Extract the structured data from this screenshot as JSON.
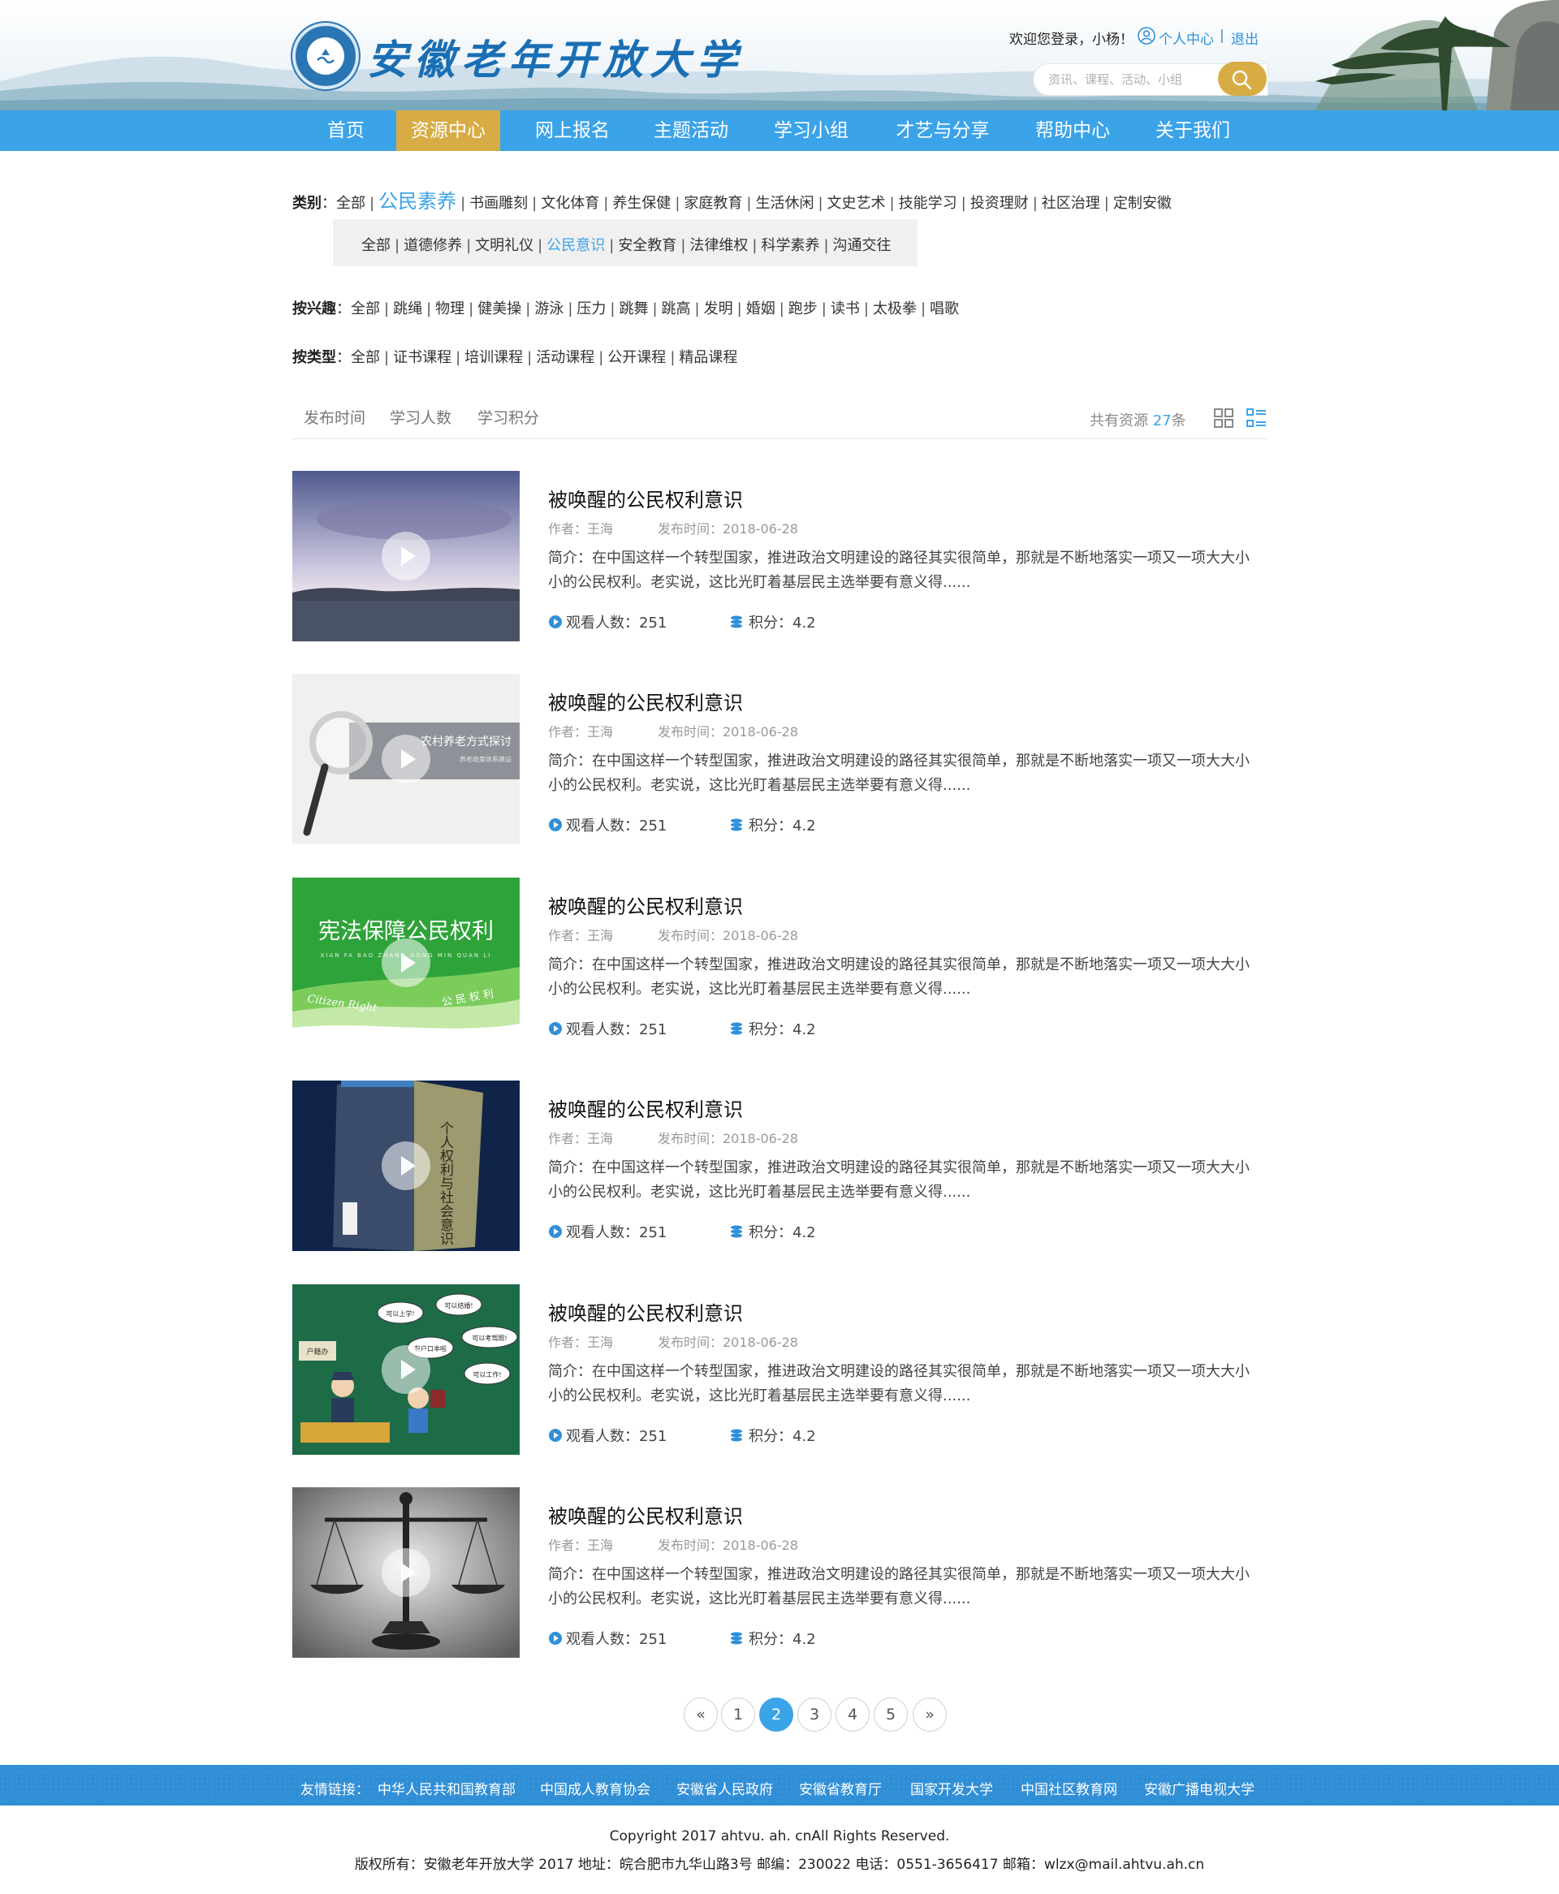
{
  "header": {
    "site_title": "安徽老年开放大学",
    "welcome": "欢迎您登录，小杨！",
    "user_center": "个人中心",
    "separator": "|",
    "logout": "退出",
    "search_placeholder": "资讯、课程、活动、小组"
  },
  "nav": {
    "items": [
      "首页",
      "资源中心",
      "网上报名",
      "主题活动",
      "学习小组",
      "才艺与分享",
      "帮助中心",
      "关于我们"
    ],
    "active_index": 1
  },
  "filters": {
    "category_label": "类别",
    "category_options": [
      "全部",
      "公民素养",
      "书画雕刻",
      "文化体育",
      "养生保健",
      "家庭教育",
      "生活休闲",
      "文史艺术",
      "技能学习",
      "投资理财",
      "社区治理",
      "定制安徽"
    ],
    "category_selected": "公民素养",
    "sub_options": [
      "全部",
      "道德修养",
      "文明礼仪",
      "公民意识",
      "安全教育",
      "法律维权",
      "科学素养",
      "沟通交往"
    ],
    "sub_selected": "公民意识",
    "interest_label": "按兴趣",
    "interest_options": [
      "全部",
      "跳绳",
      "物理",
      "健美操",
      "游泳",
      "压力",
      "跳舞",
      "跳高",
      "发明",
      "婚姻",
      "跑步",
      "读书",
      "太极拳",
      "唱歌"
    ],
    "type_label": "按类型",
    "type_options": [
      "全部",
      "证书课程",
      "培训课程",
      "活动课程",
      "公开课程",
      "精品课程"
    ]
  },
  "sortbar": {
    "tabs": [
      "发布时间",
      "学习人数",
      "学习积分"
    ],
    "active_index": 0,
    "total_prefix": "共有资源",
    "total_count": "27",
    "total_suffix": "条"
  },
  "list": {
    "items": [
      {
        "title": "被唤醒的公民权利意识",
        "author": "作者：王海",
        "date": "发布时间：2018-06-28",
        "desc": "简介：在中国这样一个转型国家，推进政治文明建设的路径其实很简单，那就是不断地落实一项又一项大大小小的公民权利。老实说，这比光盯着基层民主选举要有意义得......",
        "views": "观看人数：251",
        "points": "积分：4.2",
        "thumb": "lake"
      },
      {
        "title": "被唤醒的公民权利意识",
        "author": "作者：王海",
        "date": "发布时间：2018-06-28",
        "desc": "简介：在中国这样一个转型国家，推进政治文明建设的路径其实很简单，那就是不断地落实一项又一项大大小小的公民权利。老实说，这比光盯着基层民主选举要有意义得......",
        "views": "观看人数：251",
        "points": "积分：4.2",
        "thumb": "magnifier",
        "thumb_text": "农村养老方式探讨",
        "thumb_subtext": "养老政策体系建设"
      },
      {
        "title": "被唤醒的公民权利意识",
        "author": "作者：王海",
        "date": "发布时间：2018-06-28",
        "desc": "简介：在中国这样一个转型国家，推进政治文明建设的路径其实很简单，那就是不断地落实一项又一项大大小小的公民权利。老实说，这比光盯着基层民主选举要有意义得......",
        "views": "观看人数：251",
        "points": "积分：4.2",
        "thumb": "green",
        "thumb_text": "宪法保障公民权利",
        "thumb_pinyin": "XIAN FA BAO ZHANG GONG MIN QUAN LI",
        "thumb_en": "Citizen  Right",
        "thumb_cn": "公 民   权 利"
      },
      {
        "title": "被唤醒的公民权利意识",
        "author": "作者：王海",
        "date": "发布时间：2018-06-28",
        "desc": "简介：在中国这样一个转型国家，推进政治文明建设的路径其实很简单，那就是不断地落实一项又一项大大小小的公民权利。老实说，这比光盯着基层民主选举要有意义得......",
        "views": "观看人数：251",
        "points": "积分：4.2",
        "thumb": "book",
        "thumb_text": "个人权利与社会意识"
      },
      {
        "title": "被唤醒的公民权利意识",
        "author": "作者：王海",
        "date": "发布时间：2018-06-28",
        "desc": "简介：在中国这样一个转型国家，推进政治文明建设的路径其实很简单，那就是不断地落实一项又一项大大小小的公民权利。老实说，这比光盯着基层民主选举要有意义得......",
        "views": "观看人数：251",
        "points": "积分：4.2",
        "thumb": "cartoon",
        "thumb_sign": "户籍办",
        "thumb_bubbles": [
          "可以上学!",
          "可以结婚!",
          "有户口本啦",
          "可以考驾照!",
          "可以工作!"
        ]
      },
      {
        "title": "被唤醒的公民权利意识",
        "author": "作者：王海",
        "date": "发布时间：2018-06-28",
        "desc": "简介：在中国这样一个转型国家，推进政治文明建设的路径其实很简单，那就是不断地落实一项又一项大大小小的公民权利。老实说，这比光盯着基层民主选举要有意义得......",
        "views": "观看人数：251",
        "points": "积分：4.2",
        "thumb": "scale"
      }
    ]
  },
  "pagination": {
    "prev": "«",
    "pages": [
      "1",
      "2",
      "3",
      "4",
      "5"
    ],
    "current": "2",
    "next": "»"
  },
  "footer": {
    "links_label": "友情链接：",
    "links": [
      "中华人民共和国教育部",
      "中国成人教育协会",
      "安徽省人民政府",
      "安徽省教育厅",
      "国家开发大学",
      "中国社区教育网",
      "安徽广播电视大学"
    ],
    "copyright": "Copyright 2017 ahtvu. ah. cnAll Rights Reserved.",
    "info": "版权所有：安徽老年开放大学 2017 地址：皖合肥市九华山路3号 邮编：230022 电话：0551-3656417 邮箱：wlzx@mail.ahtvu.ah.cn"
  },
  "colors": {
    "accent": "#3ba3e8",
    "gold": "#d7ac44",
    "footer_blue": "#2f8ed6"
  }
}
